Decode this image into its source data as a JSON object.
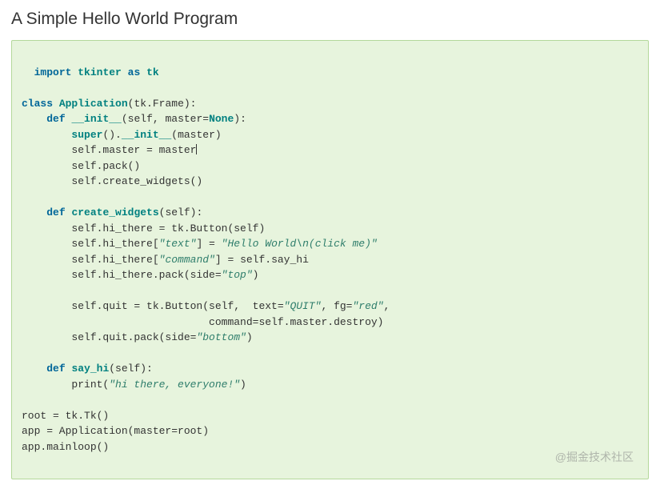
{
  "heading": "A Simple Hello World Program",
  "watermark": "@掘金技术社区",
  "code": {
    "tokens": [
      {
        "c": "kw",
        "t": "import"
      },
      {
        "c": "pln",
        "t": " "
      },
      {
        "c": "nm",
        "t": "tkinter"
      },
      {
        "c": "pln",
        "t": " "
      },
      {
        "c": "kw",
        "t": "as"
      },
      {
        "c": "pln",
        "t": " "
      },
      {
        "c": "nm",
        "t": "tk"
      },
      {
        "c": "pln",
        "t": "\n\n"
      },
      {
        "c": "kw",
        "t": "class"
      },
      {
        "c": "pln",
        "t": " "
      },
      {
        "c": "nm",
        "t": "Application"
      },
      {
        "c": "pln",
        "t": "(tk.Frame):\n"
      },
      {
        "c": "pln",
        "t": "    "
      },
      {
        "c": "kw",
        "t": "def"
      },
      {
        "c": "pln",
        "t": " "
      },
      {
        "c": "nm",
        "t": "__init__"
      },
      {
        "c": "pln",
        "t": "(self, master="
      },
      {
        "c": "nm",
        "t": "None"
      },
      {
        "c": "pln",
        "t": "):\n"
      },
      {
        "c": "pln",
        "t": "        "
      },
      {
        "c": "nm",
        "t": "super"
      },
      {
        "c": "pln",
        "t": "()."
      },
      {
        "c": "nm",
        "t": "__init__"
      },
      {
        "c": "pln",
        "t": "(master)\n"
      },
      {
        "c": "pln",
        "t": "        self.master = master"
      },
      {
        "c": "cursor",
        "t": ""
      },
      {
        "c": "pln",
        "t": "\n"
      },
      {
        "c": "pln",
        "t": "        self.pack()\n"
      },
      {
        "c": "pln",
        "t": "        self.create_widgets()\n\n"
      },
      {
        "c": "pln",
        "t": "    "
      },
      {
        "c": "kw",
        "t": "def"
      },
      {
        "c": "pln",
        "t": " "
      },
      {
        "c": "nm",
        "t": "create_widgets"
      },
      {
        "c": "pln",
        "t": "(self):\n"
      },
      {
        "c": "pln",
        "t": "        self.hi_there = tk.Button(self)\n"
      },
      {
        "c": "pln",
        "t": "        self.hi_there["
      },
      {
        "c": "str",
        "t": "\"text\""
      },
      {
        "c": "pln",
        "t": "] = "
      },
      {
        "c": "str",
        "t": "\"Hello World\\n(click me)\""
      },
      {
        "c": "pln",
        "t": "\n"
      },
      {
        "c": "pln",
        "t": "        self.hi_there["
      },
      {
        "c": "str",
        "t": "\"command\""
      },
      {
        "c": "pln",
        "t": "] = self.say_hi\n"
      },
      {
        "c": "pln",
        "t": "        self.hi_there.pack(side="
      },
      {
        "c": "str",
        "t": "\"top\""
      },
      {
        "c": "pln",
        "t": ")\n\n"
      },
      {
        "c": "pln",
        "t": "        self.quit = tk.Button(self,  text="
      },
      {
        "c": "str",
        "t": "\"QUIT\""
      },
      {
        "c": "pln",
        "t": ", fg="
      },
      {
        "c": "str",
        "t": "\"red\""
      },
      {
        "c": "pln",
        "t": ",\n"
      },
      {
        "c": "pln",
        "t": "                              command=self.master.destroy)\n"
      },
      {
        "c": "pln",
        "t": "        self.quit.pack(side="
      },
      {
        "c": "str",
        "t": "\"bottom\""
      },
      {
        "c": "pln",
        "t": ")\n\n"
      },
      {
        "c": "pln",
        "t": "    "
      },
      {
        "c": "kw",
        "t": "def"
      },
      {
        "c": "pln",
        "t": " "
      },
      {
        "c": "nm",
        "t": "say_hi"
      },
      {
        "c": "pln",
        "t": "(self):\n"
      },
      {
        "c": "pln",
        "t": "        print("
      },
      {
        "c": "str",
        "t": "\"hi there, everyone!\""
      },
      {
        "c": "pln",
        "t": ")\n\n"
      },
      {
        "c": "pln",
        "t": "root = tk.Tk()\n"
      },
      {
        "c": "pln",
        "t": "app = Application(master=root)\n"
      },
      {
        "c": "pln",
        "t": "app.mainloop()"
      }
    ]
  }
}
